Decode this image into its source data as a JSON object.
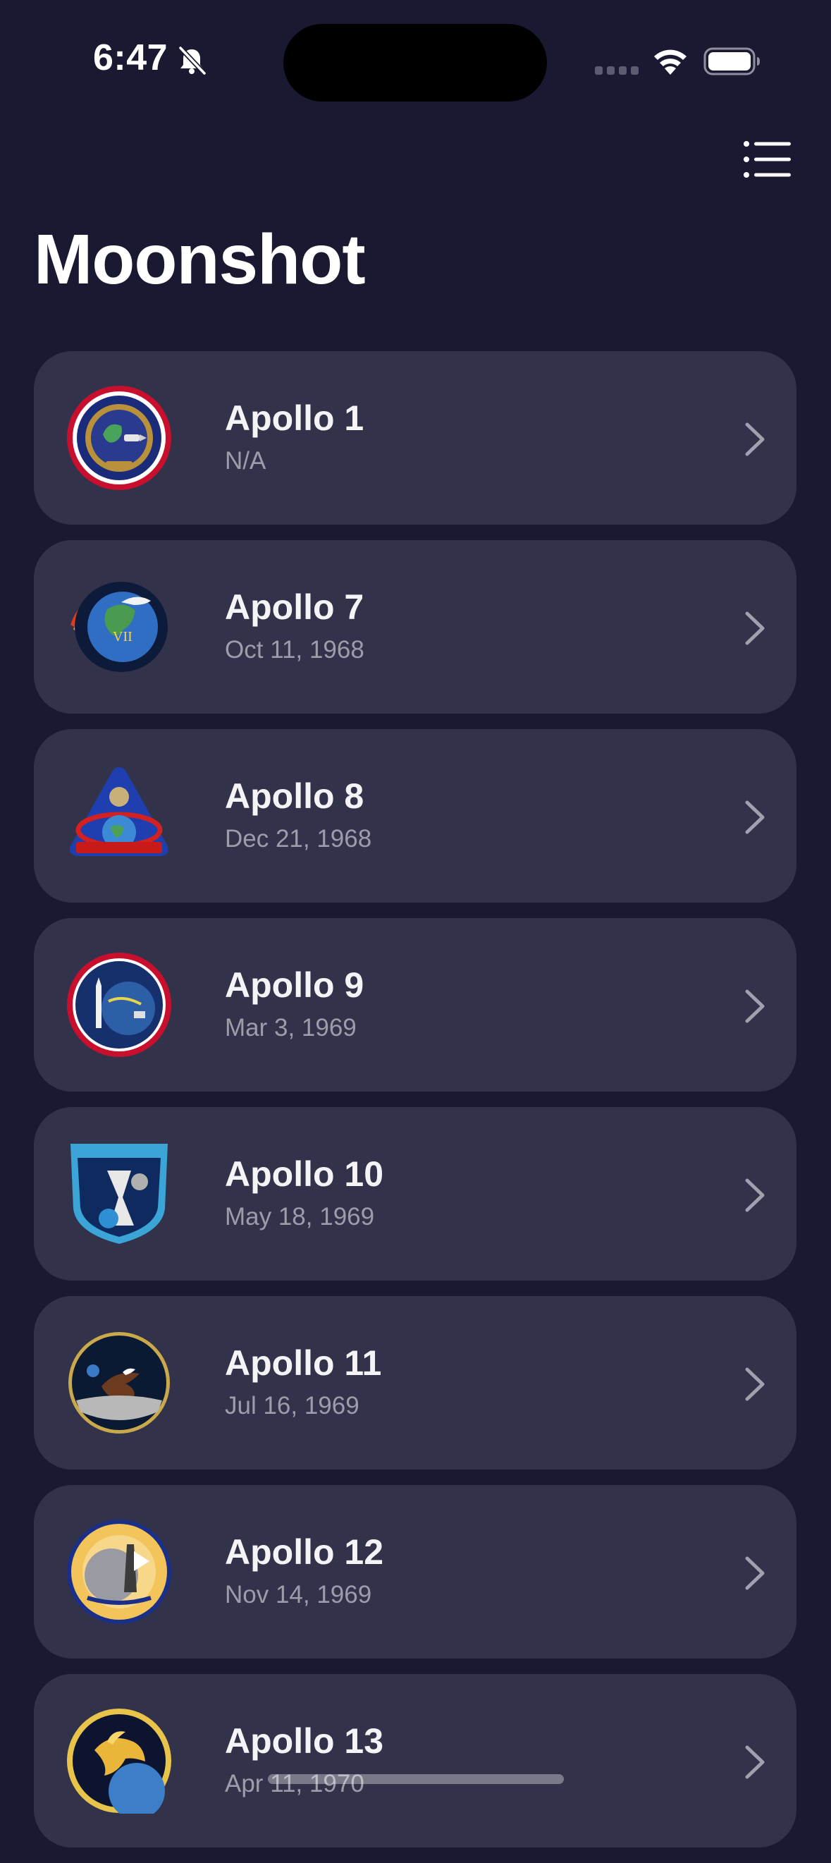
{
  "status_bar": {
    "time": "6:47",
    "silent_icon": "bell-slash-icon",
    "wifi_icon": "wifi-icon",
    "battery_icon": "battery-full-icon",
    "signal_icon": "cellular-signal-icon"
  },
  "nav": {
    "menu_icon": "list-bullet-icon",
    "title": "Moonshot"
  },
  "missions": [
    {
      "name": "Apollo 1",
      "date": "N/A"
    },
    {
      "name": "Apollo 7",
      "date": "Oct 11, 1968"
    },
    {
      "name": "Apollo 8",
      "date": "Dec 21, 1968"
    },
    {
      "name": "Apollo 9",
      "date": "Mar 3, 1969"
    },
    {
      "name": "Apollo 10",
      "date": "May 18, 1969"
    },
    {
      "name": "Apollo 11",
      "date": "Jul 16, 1969"
    },
    {
      "name": "Apollo 12",
      "date": "Nov 14, 1969"
    },
    {
      "name": "Apollo 13",
      "date": "Apr 11, 1970"
    }
  ],
  "colors": {
    "background": "#191a31",
    "card": "#32334a",
    "title": "#ffffff",
    "subtitle": "#9c9cab",
    "chevron": "#a0a0b0"
  }
}
